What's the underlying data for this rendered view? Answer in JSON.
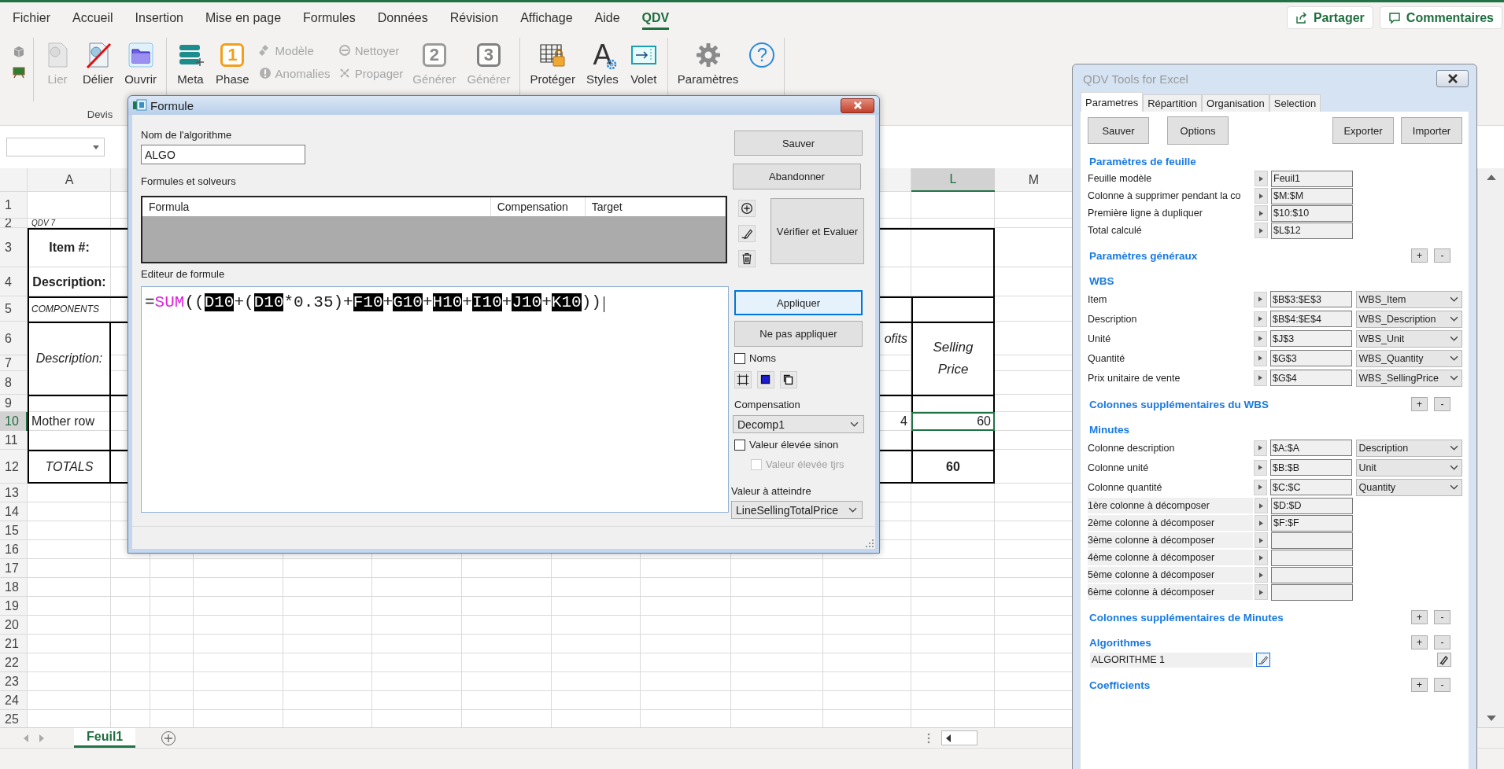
{
  "ribbon_tabs": [
    {
      "label": "Fichier",
      "selected": false
    },
    {
      "label": "Accueil",
      "selected": false
    },
    {
      "label": "Insertion",
      "selected": false
    },
    {
      "label": "Mise en page",
      "selected": false
    },
    {
      "label": "Formules",
      "selected": false
    },
    {
      "label": "Données",
      "selected": false
    },
    {
      "label": "Révision",
      "selected": false
    },
    {
      "label": "Affichage",
      "selected": false
    },
    {
      "label": "Aide",
      "selected": false
    },
    {
      "label": "QDV",
      "selected": true
    }
  ],
  "header_buttons": [
    {
      "label": "Partager"
    },
    {
      "label": "Commentaires"
    }
  ],
  "ribbon_groups": [
    {
      "label": "Devis",
      "items": [
        {
          "kind": "large",
          "label": "Lier",
          "disabled": true
        },
        {
          "kind": "large",
          "label": "Délier",
          "disabled": false
        },
        {
          "kind": "large",
          "label": "Ouvrir",
          "disabled": false
        }
      ]
    },
    {
      "items": [
        {
          "kind": "large",
          "label": "Meta",
          "disabled": false
        },
        {
          "kind": "large",
          "label": "Phase",
          "symbol": "1",
          "disabled": false
        },
        {
          "kind": "small",
          "label": "Modèle",
          "disabled": true
        },
        {
          "kind": "small",
          "label": "Anomalies",
          "disabled": true
        },
        {
          "kind": "small",
          "label": "Nettoyer",
          "disabled": true
        },
        {
          "kind": "small",
          "label": "Propager",
          "disabled": true
        },
        {
          "kind": "large",
          "label": "Générer",
          "symbol": "2",
          "disabled": true
        },
        {
          "kind": "large",
          "label": "Générer",
          "symbol": "3",
          "disabled": true
        }
      ]
    },
    {
      "items": [
        {
          "kind": "large",
          "label": "Protéger",
          "disabled": false
        },
        {
          "kind": "large",
          "label": "Styles",
          "symbol": "A",
          "disabled": false
        },
        {
          "kind": "large",
          "label": "Volet",
          "disabled": false
        }
      ]
    },
    {
      "items": [
        {
          "kind": "large",
          "label": "Paramètres",
          "disabled": false
        },
        {
          "kind": "large",
          "symbol": "?",
          "disabled": false
        }
      ]
    }
  ],
  "columns": [
    {
      "label": "A",
      "selected": false
    },
    {
      "label": "L",
      "selected": true
    },
    {
      "label": "M",
      "selected": false
    }
  ],
  "rows": [
    {
      "number": "1",
      "selected": false
    },
    {
      "number": "2",
      "selected": false,
      "column_a": {
        "text": "QDV 7",
        "selected": false
      }
    },
    {
      "number": "3",
      "selected": false,
      "column_a": {
        "text": "Item #:",
        "selected": false
      }
    },
    {
      "number": "4",
      "selected": false,
      "column_a": {
        "text": "Description:",
        "selected": false
      }
    },
    {
      "number": "5",
      "selected": false,
      "column_a": {
        "text": "COMPONENTS",
        "selected": false
      }
    },
    {
      "number": "6",
      "selected": false,
      "column_a": {
        "text": "Description:",
        "selected": false
      },
      "column_k": {
        "text": "ofits",
        "selected": false
      },
      "column_l": {
        "text": "Selling Price",
        "selected": false
      }
    },
    {
      "number": "7",
      "selected": false
    },
    {
      "number": "8",
      "selected": false
    },
    {
      "number": "9",
      "selected": false
    },
    {
      "number": "10",
      "selected": true,
      "column_a": {
        "text": "Mother row",
        "selected": false
      },
      "column_k": {
        "text": "4",
        "selected": false
      },
      "column_l": {
        "text": "60",
        "selected": true
      }
    },
    {
      "number": "11",
      "selected": false
    },
    {
      "number": "12",
      "selected": false,
      "column_a": {
        "text": "TOTALS",
        "selected": false
      },
      "column_l": {
        "text": "60",
        "selected": false
      }
    },
    {
      "number": "13",
      "selected": false
    },
    {
      "number": "14",
      "selected": false
    },
    {
      "number": "15",
      "selected": false
    },
    {
      "number": "16",
      "selected": false
    },
    {
      "number": "17",
      "selected": false
    },
    {
      "number": "18",
      "selected": false
    },
    {
      "number": "19",
      "selected": false
    },
    {
      "number": "20",
      "selected": false
    },
    {
      "number": "21",
      "selected": false
    },
    {
      "number": "22",
      "selected": false
    },
    {
      "number": "23",
      "selected": false
    },
    {
      "number": "24",
      "selected": false
    },
    {
      "number": "25",
      "selected": false
    }
  ],
  "sheet_tabs": [
    {
      "label": "Feuil1",
      "selected": true
    }
  ],
  "formula_dialog": {
    "title": "Formule",
    "name_label": "Nom de l'algorithme",
    "name_value": "ALGO",
    "save_button": "Sauver",
    "abandon_button": "Abandonner",
    "list_label": "Formules et solveurs",
    "list_columns": [
      "Formula",
      "Compensation",
      "Target"
    ],
    "verify_button": "Vérifier et Evaluer",
    "editor_label": "Editeur de formule",
    "formula": [
      {
        "kind": "op",
        "text": "="
      },
      {
        "kind": "function",
        "text": "SUM"
      },
      {
        "kind": "op",
        "text": "(("
      },
      {
        "kind": "ref",
        "text": "D10"
      },
      {
        "kind": "op",
        "text": "+("
      },
      {
        "kind": "ref",
        "text": "D10"
      },
      {
        "kind": "op",
        "text": "*0.35)+"
      },
      {
        "kind": "ref",
        "text": "F10"
      },
      {
        "kind": "op",
        "text": "+"
      },
      {
        "kind": "ref",
        "text": "G10"
      },
      {
        "kind": "op",
        "text": "+"
      },
      {
        "kind": "ref",
        "text": "H10"
      },
      {
        "kind": "op",
        "text": "+"
      },
      {
        "kind": "ref",
        "text": "I10"
      },
      {
        "kind": "op",
        "text": "+"
      },
      {
        "kind": "ref",
        "text": "J10"
      },
      {
        "kind": "op",
        "text": "+"
      },
      {
        "kind": "ref",
        "text": "K10"
      },
      {
        "kind": "op",
        "text": "))"
      }
    ],
    "apply_button": {
      "label": "Appliquer",
      "focused": true
    },
    "no_apply_button": "Ne pas appliquer",
    "names_checkbox": {
      "label": "Noms",
      "checked": false,
      "disabled": false
    },
    "compensation_label": "Compensation",
    "compensation_value": "Decomp1",
    "high_if_not": {
      "label": "Valeur élevée sinon",
      "checked": false,
      "disabled": false
    },
    "high_always": {
      "label": "Valeur élevée tjrs",
      "checked": false,
      "disabled": true
    },
    "target_label": "Valeur à atteindre",
    "target_value": "LineSellingTotalPrice"
  },
  "qdv_panel": {
    "title": "QDV Tools for Excel",
    "tabs": [
      {
        "label": "Parametres",
        "selected": true
      },
      {
        "label": "Répartition",
        "selected": false
      },
      {
        "label": "Organisation",
        "selected": false
      },
      {
        "label": "Selection",
        "selected": false
      }
    ],
    "buttons": [
      "Sauver",
      "Options",
      "Exporter",
      "Importer"
    ],
    "sections": [
      {
        "title": "Paramètres de feuille",
        "rows": [
          {
            "kind": "field",
            "label": "Feuille modèle",
            "value": "Feuil1"
          },
          {
            "kind": "field",
            "label": "Colonne à supprimer pendant la co",
            "value": "$M:$M"
          },
          {
            "kind": "field",
            "label": "Première ligne à dupliquer",
            "value": "$10:$10"
          },
          {
            "kind": "field",
            "label": "Total calculé",
            "value": "$L$12"
          }
        ]
      },
      {
        "title": "Paramètres généraux",
        "actions": [
          "+",
          "-"
        ]
      },
      {
        "title": "WBS",
        "rows": [
          {
            "kind": "select",
            "label": "Item",
            "value": "$B$3:$E$3",
            "option": "WBS_Item"
          },
          {
            "kind": "select",
            "label": "Description",
            "value": "$B$4:$E$4",
            "option": "WBS_Description"
          },
          {
            "kind": "select",
            "label": "Unité",
            "value": "$J$3",
            "option": "WBS_Unit"
          },
          {
            "kind": "select",
            "label": "Quantité",
            "value": "$G$3",
            "option": "WBS_Quantity"
          },
          {
            "kind": "select",
            "label": "Prix unitaire de vente",
            "value": "$G$4",
            "option": "WBS_SellingPrice"
          }
        ]
      },
      {
        "title": "Colonnes supplémentaires du WBS",
        "actions": [
          "+",
          "-"
        ]
      },
      {
        "title": "Minutes",
        "rows": [
          {
            "kind": "select",
            "label": "Colonne description",
            "value": "$A:$A",
            "option": "Description"
          },
          {
            "kind": "select",
            "label": "Colonne unité",
            "value": "$B:$B",
            "option": "Unit"
          },
          {
            "kind": "select",
            "label": "Colonne quantité",
            "value": "$C:$C",
            "option": "Quantity"
          },
          {
            "kind": "shaded",
            "label": "1ère colonne à décomposer",
            "value": "$D:$D"
          },
          {
            "kind": "shaded",
            "label": "2ème colonne à décomposer",
            "value": "$F:$F"
          },
          {
            "kind": "shaded",
            "label": "3ème colonne à décomposer"
          },
          {
            "kind": "shaded",
            "label": "4ème colonne à décomposer"
          },
          {
            "kind": "shaded",
            "label": "5ème colonne à décomposer"
          },
          {
            "kind": "shaded",
            "label": "6ème colonne à décomposer"
          }
        ]
      },
      {
        "title": "Colonnes supplémentaires de Minutes",
        "actions": [
          "+",
          "-"
        ]
      },
      {
        "title": "Algorithmes",
        "actions": [
          "+",
          "-"
        ],
        "rows": [
          {
            "kind": "algorithm",
            "label": "ALGORITHME 1"
          }
        ]
      },
      {
        "title": "Coefficients",
        "actions": [
          "+",
          "-"
        ]
      }
    ]
  }
}
